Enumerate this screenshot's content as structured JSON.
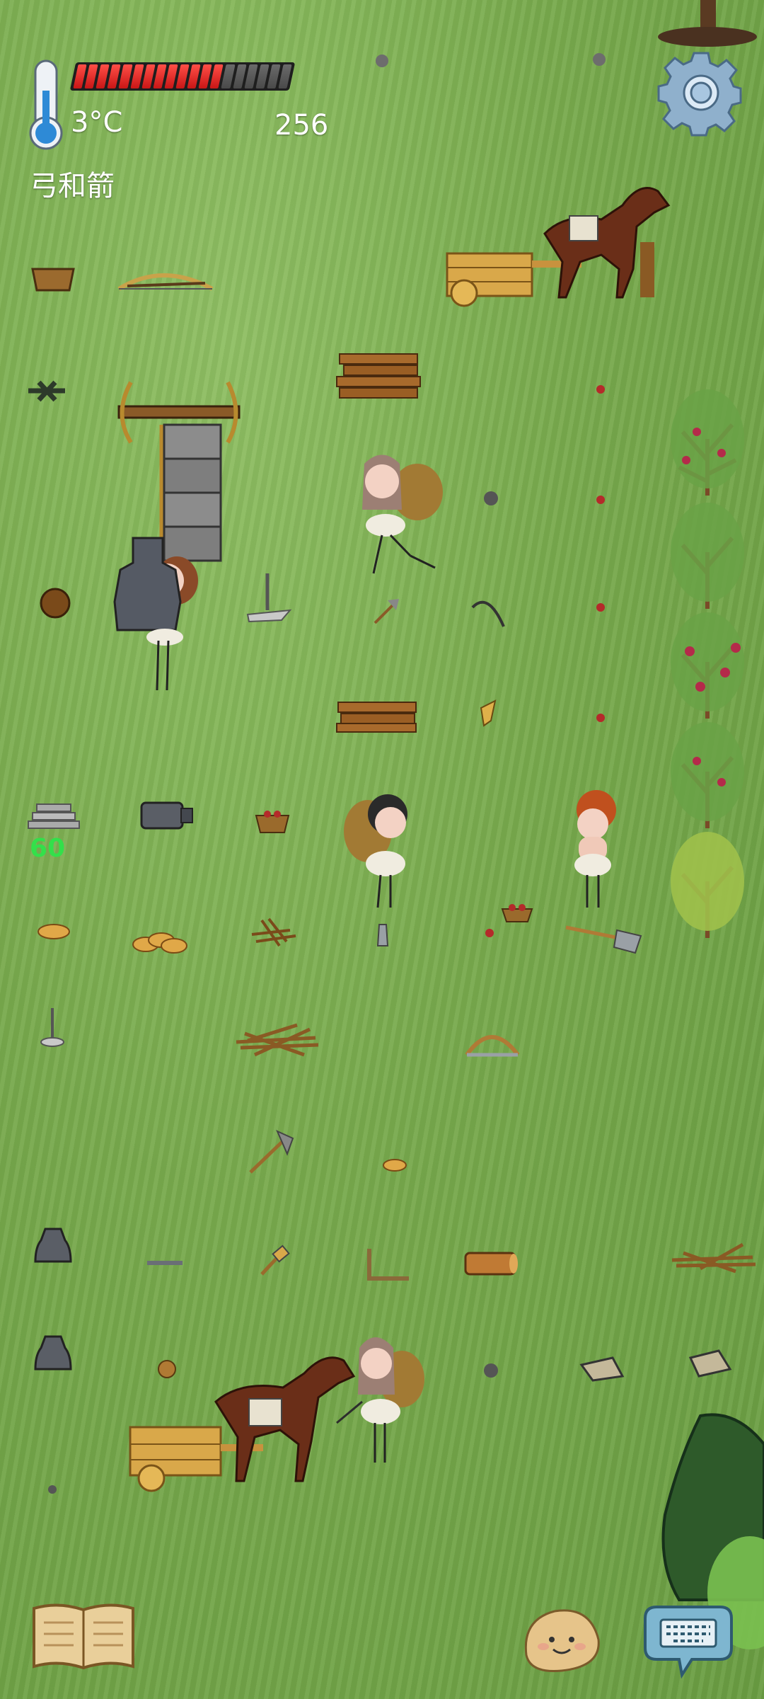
{
  "hud": {
    "temperature": "3°C",
    "age_counter": "256",
    "held_item": "弓和箭",
    "hunger": {
      "filled": 13,
      "total": 19
    },
    "stack_count": "60"
  },
  "colors": {
    "grass": "#78aa4d",
    "hunger_full": "#e21f1f",
    "hunger_empty": "#5a5a5a",
    "counter_green": "#33e04a"
  },
  "icons": {
    "settings": "gear-icon",
    "recipes": "book-icon",
    "emote": "face-icon",
    "chat": "keyboard-icon"
  }
}
